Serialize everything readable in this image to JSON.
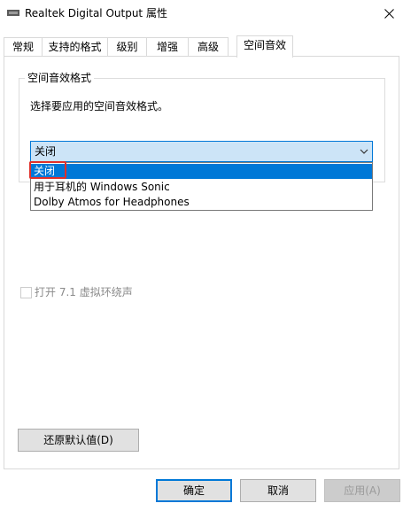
{
  "window": {
    "title": "Realtek Digital Output 属性",
    "icon": "speaker-icon",
    "close_icon": "close-icon"
  },
  "tabs": [
    {
      "label": "常规"
    },
    {
      "label": "支持的格式"
    },
    {
      "label": "级别"
    },
    {
      "label": "增强"
    },
    {
      "label": "高级"
    },
    {
      "label": "空间音效",
      "active": true
    }
  ],
  "spatial": {
    "group_title": "空间音效格式",
    "description": "选择要应用的空间音效格式。",
    "selected_value": "关闭",
    "options": [
      "关闭",
      "用于耳机的 Windows Sonic",
      "Dolby Atmos for Headphones"
    ],
    "checkbox_label": "打开 7.1 虚拟环绕声",
    "checkbox_checked": false,
    "restore_label": "还原默认值(D)"
  },
  "footer": {
    "ok_label": "确定",
    "cancel_label": "取消",
    "apply_label": "应用(A)"
  },
  "colors": {
    "accent": "#0078d7",
    "highlight_mark": "#e0302a"
  }
}
